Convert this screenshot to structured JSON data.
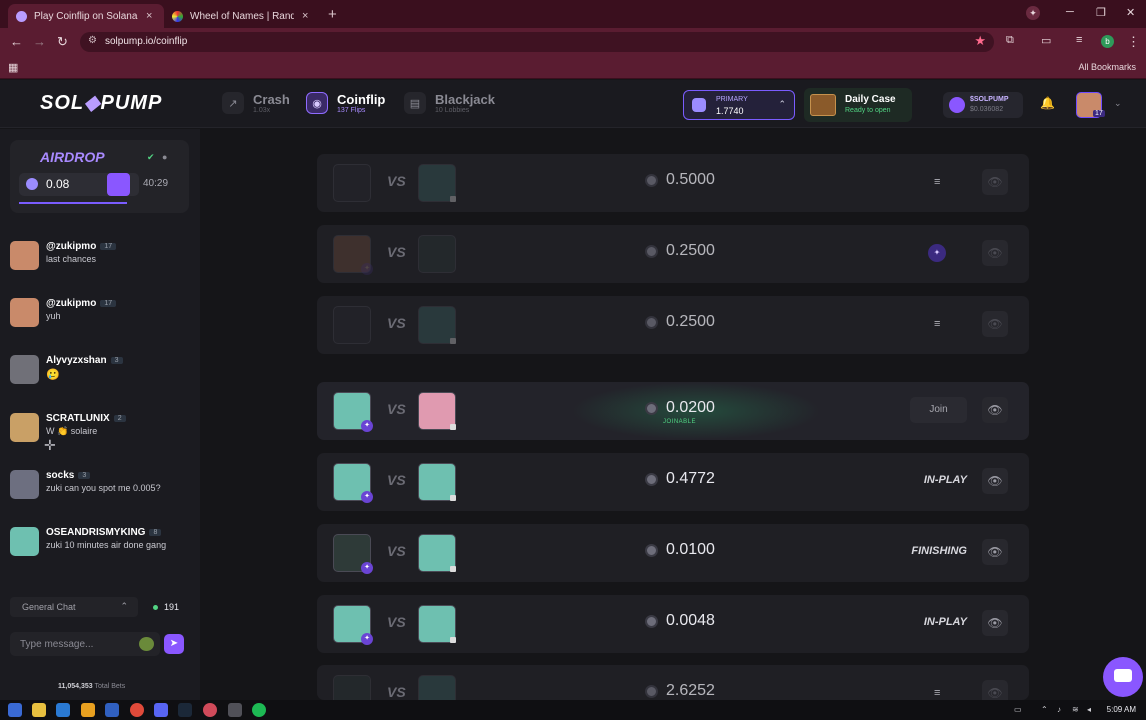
{
  "browser": {
    "tabs": [
      {
        "title": "Play Coinflip on Solana – No KYC",
        "close": "×"
      },
      {
        "title": "Wheel of Names | Random name",
        "close": "×"
      }
    ],
    "new_tab": "+",
    "url": "solpump.io/coinflip",
    "bookmarks_label": "All Bookmarks"
  },
  "header": {
    "logo_left": "SOL",
    "logo_right": "PUMP",
    "nav": [
      {
        "label": "Crash",
        "sub": "1.03x"
      },
      {
        "label": "Coinflip",
        "sub": "137 Flips"
      },
      {
        "label": "Blackjack",
        "sub": "10 Lobbies"
      }
    ],
    "wallet": {
      "label": "PRIMARY",
      "value": "1.7740"
    },
    "daily_case": {
      "title": "Daily Case",
      "sub": "Ready to open"
    },
    "token": {
      "name": "$SOLPUMP",
      "price": "$0.036082"
    },
    "user_level": "17"
  },
  "sidebar": {
    "airdrop": {
      "title": "AIRDROP",
      "amount": "0.08",
      "timer": "40:29"
    },
    "messages": [
      {
        "user": "@zukipmo",
        "level": "17",
        "text": "last chances",
        "color": "#c98a6a"
      },
      {
        "user": "@zukipmo",
        "level": "17",
        "text": "yuh",
        "color": "#c98a6a"
      },
      {
        "user": "Alyvyzxshan",
        "level": "3",
        "text": "",
        "color": "#707078"
      },
      {
        "user": "SCRATLUNIX",
        "level": "2",
        "text": "W 👏 solaire",
        "color": "#c9a066"
      },
      {
        "user": "socks",
        "level": "3",
        "text": "zuki can you spot me 0.005?",
        "color": "#6d6f80"
      },
      {
        "user": "OSEANDRISMYKING",
        "level": "8",
        "text": "zuki 10 minutes air done gang",
        "color": "#6ec0b0"
      }
    ],
    "chat_channel": "General Chat",
    "online_count": "191",
    "chat_placeholder": "Type message...",
    "total_bets_value": "11,054,353",
    "total_bets_label": "Total Bets"
  },
  "games": [
    {
      "amount": "0.5000",
      "state": "list",
      "dim": true,
      "label": ""
    },
    {
      "amount": "0.2500",
      "state": "live",
      "dim": true,
      "label": ""
    },
    {
      "amount": "0.2500",
      "state": "list",
      "dim": true,
      "label": ""
    },
    {
      "amount": "0.0200",
      "state": "join",
      "dim": false,
      "label": "JOINABLE",
      "button": "Join"
    },
    {
      "amount": "0.4772",
      "state": "status",
      "dim": false,
      "label": "IN-PLAY"
    },
    {
      "amount": "0.0100",
      "state": "status",
      "dim": false,
      "label": "FINISHING"
    },
    {
      "amount": "0.0048",
      "state": "status",
      "dim": false,
      "label": "IN-PLAY"
    },
    {
      "amount": "2.6252",
      "state": "list",
      "dim": true,
      "label": ""
    }
  ],
  "taskbar": {
    "time": "5:09 AM"
  },
  "colors": {
    "accent": "#8a57ff",
    "joinable": "#52d483",
    "wallet_border": "#7a5cff"
  }
}
